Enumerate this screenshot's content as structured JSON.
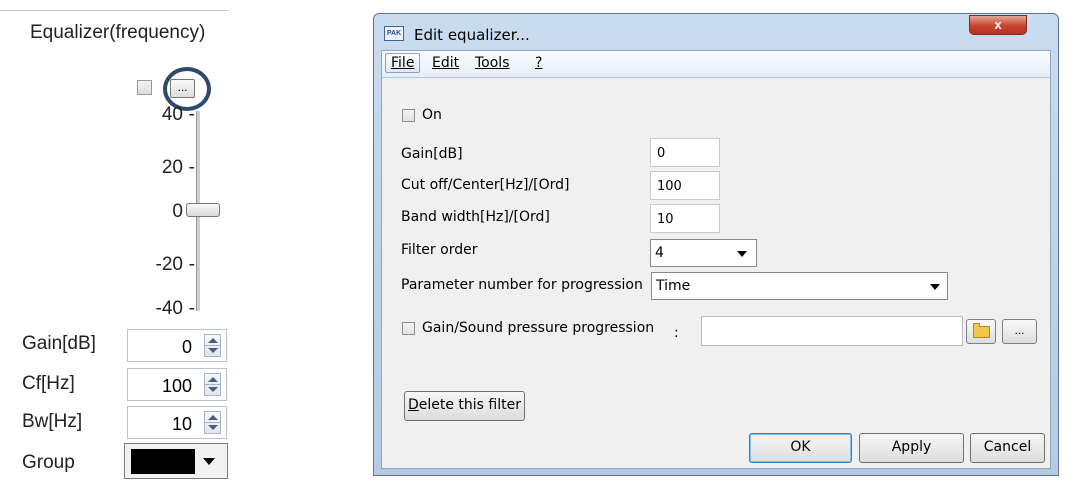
{
  "left_panel": {
    "title": "Equalizer(frequency)",
    "more_button_label": "...",
    "slider": {
      "ticks": [
        "40",
        "20",
        "0",
        "-20",
        "-40"
      ],
      "current_value_db": 0
    },
    "fields": [
      {
        "label": "Gain[dB]",
        "value": "0"
      },
      {
        "label": "Cf[Hz]",
        "value": "100"
      },
      {
        "label": "Bw[Hz]",
        "value": "10"
      }
    ],
    "group_label": "Group",
    "group_color": "#000000"
  },
  "dialog": {
    "title": "Edit equalizer...",
    "icon_text": "PAK",
    "close_label": "x",
    "menu": [
      "File",
      "Edit",
      "Tools",
      "?"
    ],
    "on_label": "On",
    "gain_label": "Gain[dB]",
    "gain_value": "0",
    "cutoff_label": "Cut off/Center[Hz]/[Ord]",
    "cutoff_value": "100",
    "bandwidth_label": "Band width[Hz]/[Ord]",
    "bandwidth_value": "10",
    "filter_order_label": "Filter order",
    "filter_order_value": "4",
    "param_label": "Parameter number for progression",
    "param_value": "Time",
    "progression_label": "Gain/Sound pressure progression",
    "progression_colon": ":",
    "progression_path": "",
    "browse_label": "...",
    "delete_label": "Delete this filter",
    "ok_label": "OK",
    "apply_label": "Apply",
    "cancel_label": "Cancel"
  }
}
